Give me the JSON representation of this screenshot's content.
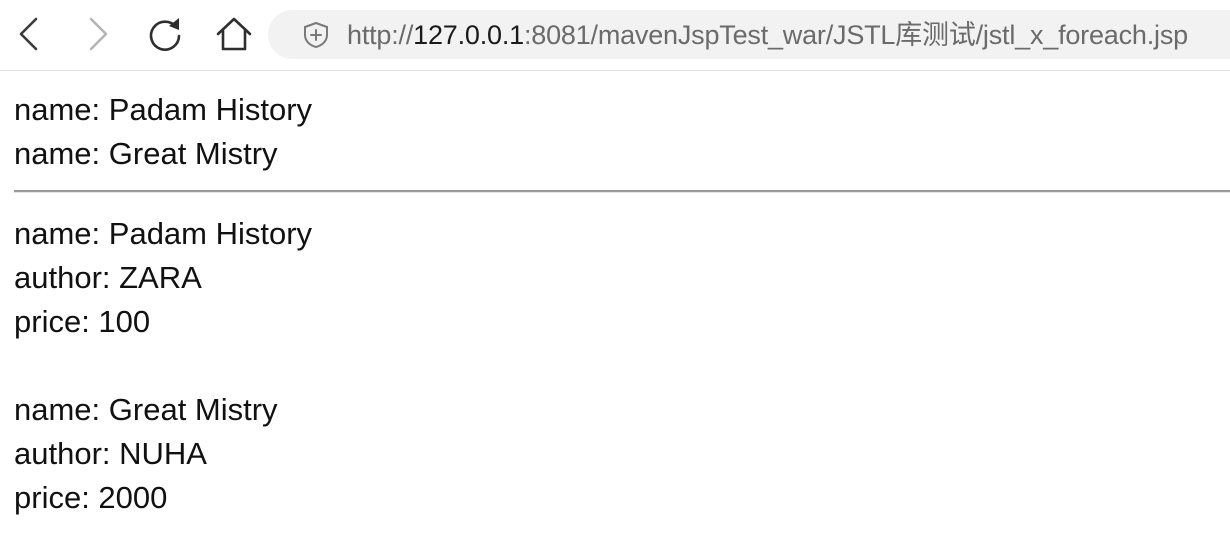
{
  "browser": {
    "url_scheme": "http://",
    "url_host": "127.0.0.1",
    "url_rest": ":8081/mavenJspTest_war/JSTL库测试/jstl_x_foreach.jsp",
    "icons": [
      "back-icon",
      "forward-icon",
      "reload-icon",
      "home-icon",
      "shield-icon"
    ]
  },
  "list1": [
    {
      "label": "name: Padam History"
    },
    {
      "label": "name: Great Mistry"
    }
  ],
  "list2": [
    {
      "name": "name: Padam History",
      "author": "author: ZARA",
      "price": "price: 100"
    },
    {
      "name": "name: Great Mistry",
      "author": "author: NUHA",
      "price": "price: 2000"
    }
  ]
}
